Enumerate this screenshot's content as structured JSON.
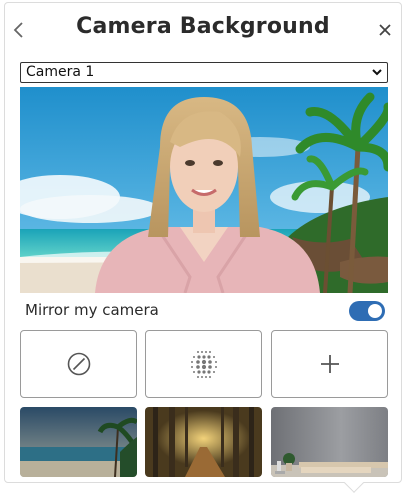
{
  "header": {
    "title": "Camera Background"
  },
  "camera_select": {
    "selected": "Camera 1"
  },
  "mirror": {
    "label": "Mirror my camera",
    "enabled": true
  },
  "colors": {
    "accent": "#2e6db4",
    "border": "#9a9a9a"
  },
  "tiles": [
    {
      "icon": "no-background-icon"
    },
    {
      "icon": "blur-icon"
    },
    {
      "icon": "plus-icon"
    }
  ],
  "thumbnails": [
    "beach-thumbnail",
    "forest-thumbnail",
    "room-thumbnail"
  ]
}
